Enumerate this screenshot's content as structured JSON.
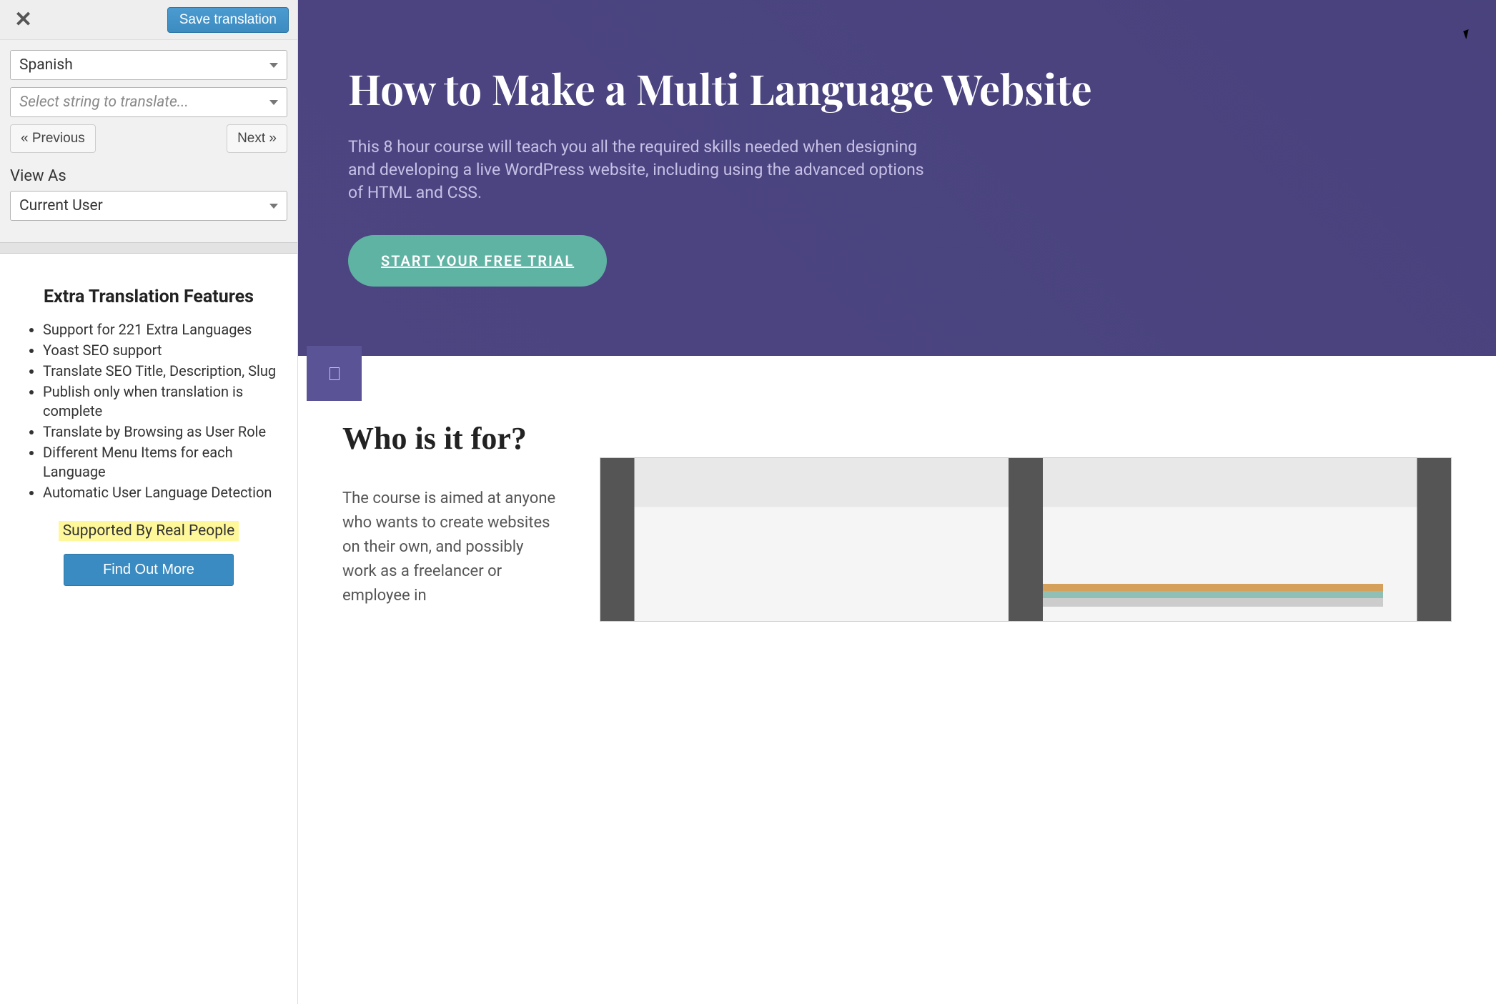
{
  "sidebar": {
    "save_label": "Save translation",
    "language_select": "Spanish",
    "string_placeholder": "Select string to translate...",
    "prev_label": "« Previous",
    "next_label": "Next »",
    "view_as_label": "View As",
    "view_as_value": "Current User"
  },
  "promo": {
    "heading": "Extra Translation Features",
    "features": [
      "Support for 221 Extra Languages",
      "Yoast SEO support",
      "Translate SEO Title, Description, Slug",
      "Publish only when translation is complete",
      "Translate by Browsing as User Role",
      "Different Menu Items for each Language",
      "Automatic User Language Detection"
    ],
    "supported": "Supported By Real People",
    "find_out": "Find Out More"
  },
  "preview": {
    "hero_title": "How to Make a Multi Language Website",
    "hero_body": "This 8 hour course will teach you all the required skills needed when designing and developing a live WordPress website, including using the advanced options of HTML and CSS.",
    "cta": "START YOUR FREE TRIAL",
    "section_title": "Who is it for?",
    "section_body": "The course is aimed at anyone who wants to create websites on their own, and possibly work as a freelancer or employee in"
  }
}
